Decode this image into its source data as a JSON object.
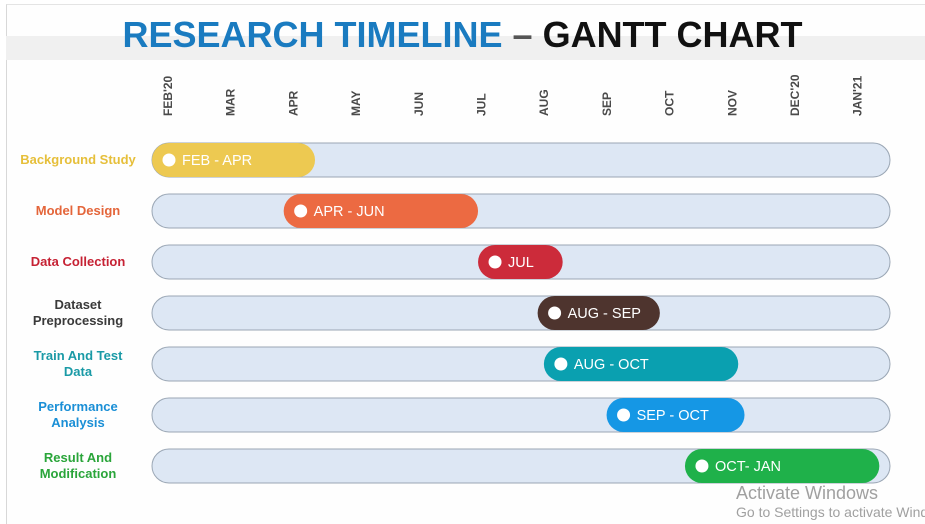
{
  "title": {
    "part1": "RESEARCH TIMELINE",
    "sep": "–",
    "part2": "GANTT CHART"
  },
  "chart_data": {
    "type": "gantt",
    "months": [
      "FEB'20",
      "MAR",
      "APR",
      "MAY",
      "JUN",
      "JUL",
      "AUG",
      "SEP",
      "OCT",
      "NOV",
      "DEC'20",
      "JAN'21"
    ],
    "tasks": [
      {
        "label": [
          "Background Study"
        ],
        "bar_label": "FEB - APR",
        "start": 0,
        "end": 2.6,
        "color": "#edc951"
      },
      {
        "label": [
          "Model Design"
        ],
        "bar_label": "APR - JUN",
        "start": 2.1,
        "end": 5.2,
        "color": "#ec6a42"
      },
      {
        "label": [
          "Data Collection"
        ],
        "bar_label": "JUL",
        "start": 5.2,
        "end": 6.55,
        "color": "#cc2b3a"
      },
      {
        "label": [
          "Dataset",
          "Preprocessing"
        ],
        "bar_label": "AUG - SEP",
        "start": 6.15,
        "end": 8.1,
        "color": "#4e342e"
      },
      {
        "label": [
          "Train And Test",
          "Data"
        ],
        "bar_label": "AUG - OCT",
        "start": 6.25,
        "end": 9.35,
        "color": "#0aa0b0"
      },
      {
        "label": [
          "Performance",
          "Analysis"
        ],
        "bar_label": "SEP - OCT",
        "start": 7.25,
        "end": 9.45,
        "color": "#1597e5"
      },
      {
        "label": [
          "Result And",
          "Modification"
        ],
        "bar_label": "OCT- JAN",
        "start": 8.5,
        "end": 11.6,
        "color": "#1fb14a"
      }
    ],
    "label_colors": [
      "#e6bf3a",
      "#e4653a",
      "#c62234",
      "#3a3a3a",
      "#1a9aa6",
      "#1a8fd6",
      "#2aa53a"
    ],
    "track_color": "#dde7f4"
  },
  "watermark": {
    "line1": "Activate Windows",
    "line2": "Go to Settings to activate Windows."
  }
}
